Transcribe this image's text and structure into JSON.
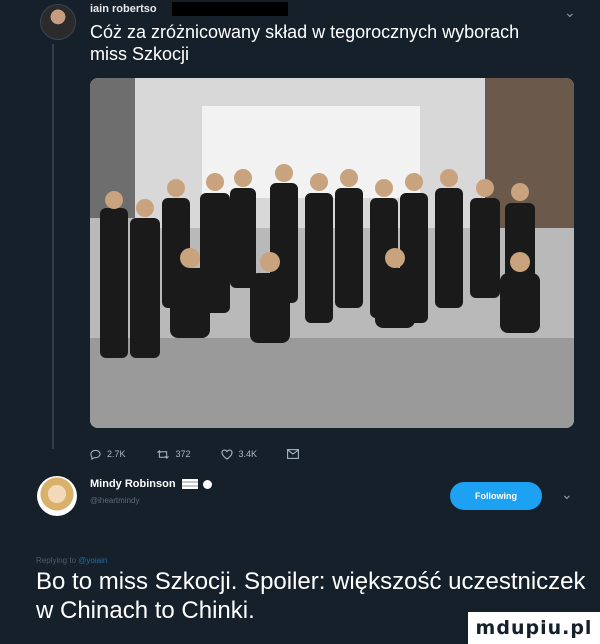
{
  "tweet1": {
    "username": "iain robertso",
    "text": "Cóż za zróżnicowany skład w tegorocznych wyborach miss Szkocji",
    "photo_icon": "group-photo-of-contestants",
    "actions": {
      "reply_count": "2.7K",
      "retweet_count": "372",
      "like_count": "3.4K"
    }
  },
  "tweet2": {
    "name": "Mindy Robinson",
    "handle": "@iheartmindy",
    "follow_label": "Following",
    "replying_prefix": "Replying to",
    "replying_to": "@yoiain",
    "text": "Bo to miss Szkocji. Spoiler: większość uczestniczek w Chinach to Chinki."
  },
  "watermark": "mdupiu.pl",
  "colors": {
    "background": "#16202b",
    "accent": "#1da1f2",
    "muted": "#8899a6"
  }
}
